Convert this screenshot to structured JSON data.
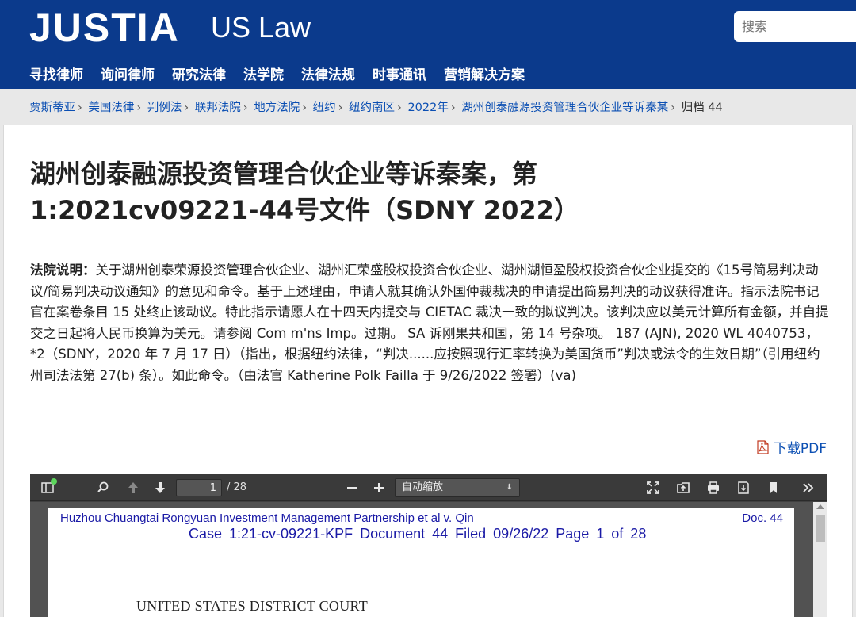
{
  "header": {
    "logo": "JUSTIA",
    "logo_sub": "US Law",
    "search_placeholder": "搜索",
    "nav": [
      "寻找律师",
      "询问律师",
      "研究法律",
      "法学院",
      "法律法规",
      "时事通讯",
      "营销解决方案"
    ]
  },
  "breadcrumb": {
    "items": [
      "贾斯蒂亚",
      "美国法律",
      "判例法",
      "联邦法院",
      "地方法院",
      "纽约",
      "纽约南区",
      "2022年",
      "湖州创泰融源投资管理合伙企业等诉秦某"
    ],
    "current": "归档 44",
    "separator": "›"
  },
  "case": {
    "title": "湖州创泰融源投资管理合伙企业等诉秦案，第 1:2021cv09221-44号文件（SDNY 2022）",
    "desc_label": "法院说明：",
    "desc_text": "关于湖州创泰荣源投资管理合伙企业、湖州汇荣盛股权投资合伙企业、湖州湖恒盈股权投资合伙企业提交的《15号简易判决动议/简易判决动议通知》的意见和命令。基于上述理由，申请人就其确认外国仲裁裁决的申请提出简易判决的动议获得准许。指示法院书记官在案卷条目 15 处终止该动议。特此指示请愿人在十四天内提交与 CIETAC 裁决一致的拟议判决。该判决应以美元计算所有金额，并自提交之日起将人民币换算为美元。请参阅 Com m'ns Imp。过期。 SA 诉刚果共和国，第 14 号杂项。 187 (AJN), 2020 WL 4040753，*2（SDNY，2020 年 7 月 17 日）（指出，根据纽约法律，“判决......应按照现行汇率转换为美国货币”判决或法令的生效日期”（引用纽约州司法法第 27(b) 条）。如此命令。（由法官 Katherine Polk Failla 于 9/26/2022 签署）(va)",
    "pdf_link": "下载PDF"
  },
  "viewer": {
    "page_current": "1",
    "page_total": "/ 28",
    "zoom": "自动缩放",
    "page_header_left": "Huzhou Chuangtai Rongyuan Investment Management Partnership et al v. Qin",
    "page_header_right": "Doc. 44",
    "case_line": "Case 1:21-cv-09221-KPF   Document 44   Filed 09/26/22   Page 1 of 28",
    "court": "UNITED STATES DISTRICT COURT"
  },
  "colors": {
    "header_bg": "#0b3a8c",
    "link": "#0b4fb3",
    "pdf_text": "#1a1aa6"
  }
}
